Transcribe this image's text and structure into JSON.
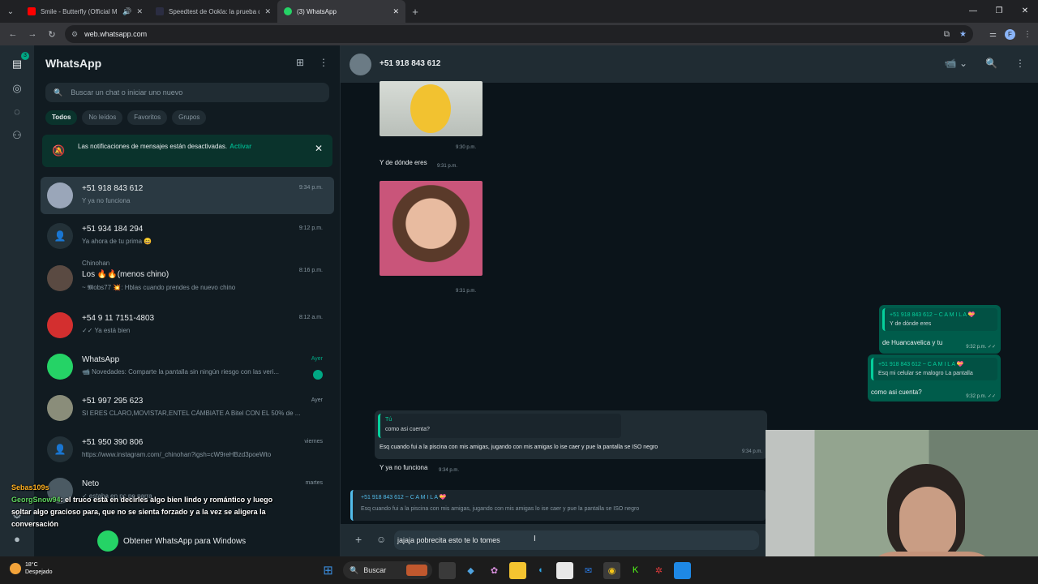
{
  "browser": {
    "tabs": [
      {
        "title": "Smile - Butterfly (Official M...",
        "color": "#ff0000",
        "active": false
      },
      {
        "title": "Speedtest de Ookla: la prueba d...",
        "color": "#141526",
        "active": false
      },
      {
        "title": "(3) WhatsApp",
        "color": "#25d366",
        "active": true
      }
    ],
    "url": "web.whatsapp.com",
    "profile_initial": "F"
  },
  "rail": {
    "badge": "3"
  },
  "sidebar": {
    "title": "WhatsApp",
    "search_placeholder": "Buscar un chat o iniciar uno nuevo",
    "filters": [
      "Todos",
      "No leídos",
      "Favoritos",
      "Grupos"
    ],
    "notification": {
      "text": "Las notificaciones de mensajes están desactivadas.",
      "action": "Activar"
    },
    "chats": [
      {
        "name": "+51 918 843 612",
        "preview": "Y ya no funciona",
        "time": "9:34 p.m."
      },
      {
        "name": "+51 934 184 294",
        "preview": "Ya ahora de tu prima 😄",
        "time": "9:12 p.m."
      },
      {
        "pre": "Chinohan",
        "name": "Los 🔥🔥(menos chino)",
        "preview": "~ 𝕸obs77 💥: Hblas cuando prendes de nuevo chino",
        "time": "8:16 p.m."
      },
      {
        "name": "+54 9 11 7151-4803",
        "preview": "✓✓ Ya está bien",
        "time": "8:12 a.m."
      },
      {
        "name": "WhatsApp",
        "preview": "📹 Novedades: Comparte la pantalla sin ningún riesgo con las veri...",
        "time": "Ayer"
      },
      {
        "name": "+51 997 295 623",
        "preview": "SI ERES CLARO,MOVISTAR,ENTEL CÁMBIATE A Bitel CON EL 50% de ...",
        "time": "Ayer"
      },
      {
        "name": "+51 950 390 806",
        "preview": "https://www.instagram.com/_chinohan?igsh=cW9reHBzd3poeWto",
        "time": "viernes"
      },
      {
        "name": "Neto",
        "preview": "✓ estaba en pc pe parra",
        "time": "martes"
      }
    ],
    "get_app": "Obtener WhatsApp para Windows"
  },
  "conversation": {
    "contact": "+51 918 843 612",
    "messages": {
      "t1": "9:30 p.m.",
      "m1": "Y de dónde eres",
      "t2": "9:31 p.m.",
      "t3": "9:31 p.m.",
      "out1_author": "+51 918 843 612  ~ C A M I L A 💝",
      "out1_quote": "Y de dónde eres",
      "out1_text": "de Huancavelica y tu",
      "out1_time": "9:32 p.m. ✓✓",
      "out2_author": "+51 918 843 612  ~ C A M I L A 💝",
      "out2_quote": "Esq mi celular se malogro La pantalla",
      "out2_text": "como asi cuenta?",
      "out2_time": "9:32 p.m. ✓✓",
      "in_quote_author": "Tú",
      "in_quote_text": "como asi cuenta?",
      "in_text": "Esq cuando fui a la piscina con mis amigas, jugando con mis amigas lo ise caer y pue la pantalla se ISO negro",
      "in_time": "9:34 p.m.",
      "last_text": "Y ya no funciona",
      "last_time": "9:34 p.m."
    },
    "reply": {
      "author": "+51 918 843 612  ~ C A M I L A 💝",
      "text": "Esq cuando fui a la piscina con mis amigas, jugando con mis amigas lo ise caer y pue la pantalla se ISO negro"
    },
    "composer_value": "jajaja pobrecita esto te lo tomes"
  },
  "stream_chat": {
    "line1_user": "Sebas109s",
    "line2_user": "GeorgSnow94",
    "line2_text": ": el truco está en decirles algo bien lindo y romántico y luego soltar algo gracioso para, que no se sienta forzado y a la vez se aligera la conversación"
  },
  "taskbar": {
    "temp": "18°C",
    "weather": "Despejado",
    "search": "Buscar"
  }
}
